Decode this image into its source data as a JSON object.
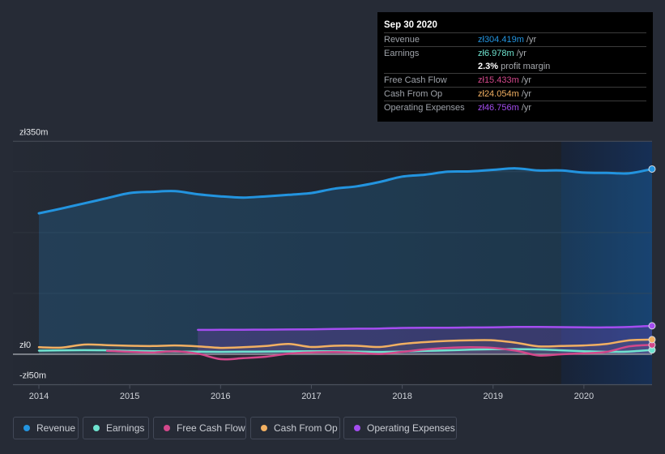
{
  "tooltip": {
    "date": "Sep 30 2020",
    "rows": [
      {
        "label": "Revenue",
        "value": "zł304.419m",
        "unit": " /yr",
        "color": "#2394df"
      },
      {
        "label": "Earnings",
        "value": "zł6.978m",
        "unit": " /yr",
        "color": "#6fe3cf"
      },
      {
        "label": "Free Cash Flow",
        "value": "zł15.433m",
        "unit": " /yr",
        "color": "#d3488b"
      },
      {
        "label": "Cash From Op",
        "value": "zł24.054m",
        "unit": " /yr",
        "color": "#f2b062"
      },
      {
        "label": "Operating Expenses",
        "value": "zł46.756m",
        "unit": " /yr",
        "color": "#a44df0"
      }
    ],
    "profit_margin": {
      "value": "2.3%",
      "label": " profit margin"
    }
  },
  "legend": {
    "items": [
      {
        "label": "Revenue",
        "color": "#2394df"
      },
      {
        "label": "Earnings",
        "color": "#6fe3cf"
      },
      {
        "label": "Free Cash Flow",
        "color": "#d3488b"
      },
      {
        "label": "Cash From Op",
        "color": "#f2b062"
      },
      {
        "label": "Operating Expenses",
        "color": "#a44df0"
      }
    ]
  },
  "chart_data": {
    "type": "line",
    "title": "",
    "xlabel": "",
    "ylabel": "",
    "xlim": [
      2014,
      2020.75
    ],
    "ylim": [
      -50,
      350
    ],
    "grid": true,
    "gridlines_y": [
      100,
      200,
      300
    ],
    "y_ticks": [
      {
        "value": 350,
        "label": "zł350m"
      },
      {
        "value": 0,
        "label": "zł0"
      },
      {
        "value": -50,
        "label": "-zł50m"
      }
    ],
    "x_ticks": [
      {
        "value": 2014,
        "label": "2014"
      },
      {
        "value": 2015,
        "label": "2015"
      },
      {
        "value": 2016,
        "label": "2016"
      },
      {
        "value": 2017,
        "label": "2017"
      },
      {
        "value": 2018,
        "label": "2018"
      },
      {
        "value": 2019,
        "label": "2019"
      },
      {
        "value": 2020,
        "label": "2020"
      }
    ],
    "highlight_range": [
      2019.75,
      2020.75
    ],
    "legend_position": "bottom",
    "x": [
      2014.0,
      2014.25,
      2014.5,
      2014.75,
      2015.0,
      2015.25,
      2015.5,
      2015.75,
      2016.0,
      2016.25,
      2016.5,
      2016.75,
      2017.0,
      2017.25,
      2017.5,
      2017.75,
      2018.0,
      2018.25,
      2018.5,
      2018.75,
      2019.0,
      2019.25,
      2019.5,
      2019.75,
      2020.0,
      2020.25,
      2020.5,
      2020.75
    ],
    "series": [
      {
        "name": "Revenue",
        "key": "revenue",
        "color": "#2394df",
        "area": true,
        "values": [
          231.6,
          239.5,
          248,
          256.5,
          265,
          267,
          268,
          263,
          259.5,
          257.5,
          259.5,
          262,
          265,
          272,
          276,
          283,
          292,
          295,
          300,
          300.5,
          303,
          305.5,
          302,
          302,
          298.5,
          298,
          297.5,
          304.419
        ]
      },
      {
        "name": "Operating Expenses",
        "key": "operating-expenses",
        "color": "#a44df0",
        "area": true,
        "values": [
          null,
          null,
          null,
          null,
          null,
          null,
          null,
          40,
          40.2,
          40.3,
          40.5,
          40.7,
          41,
          41.5,
          42,
          42.3,
          43.2,
          43.5,
          43.6,
          44,
          44.3,
          44.8,
          44.8,
          44.6,
          44.3,
          44.2,
          45,
          46.756
        ]
      },
      {
        "name": "Earnings",
        "key": "earnings",
        "color": "#6fe3cf",
        "area": false,
        "values": [
          6,
          6.5,
          6.8,
          6.5,
          5.5,
          5,
          4.5,
          4.2,
          4,
          4.2,
          4.5,
          4.8,
          5,
          4.8,
          4.5,
          3.8,
          4.5,
          5.5,
          6.5,
          7.5,
          8.3,
          8.5,
          8,
          6.5,
          5,
          4,
          4.5,
          6.978
        ]
      },
      {
        "name": "Free Cash Flow",
        "key": "free-cash-flow",
        "color": "#d3488b",
        "area": false,
        "values": [
          null,
          null,
          null,
          5.5,
          4,
          3,
          5,
          1,
          -8,
          -6.5,
          -4,
          1,
          3,
          3.5,
          2.5,
          0.5,
          4,
          8,
          10.5,
          11.5,
          10.5,
          6,
          -2,
          0,
          1.5,
          4,
          13,
          15.433
        ]
      },
      {
        "name": "Cash From Op",
        "key": "cash-from-op",
        "color": "#f2b062",
        "area": false,
        "values": [
          11.5,
          11,
          16,
          15,
          14,
          13.5,
          14.5,
          13,
          10.5,
          11.5,
          13.5,
          17,
          12,
          14,
          14,
          12,
          17,
          20,
          22,
          23,
          23,
          19,
          13,
          13.5,
          14.5,
          17,
          23,
          24.054
        ]
      }
    ]
  }
}
